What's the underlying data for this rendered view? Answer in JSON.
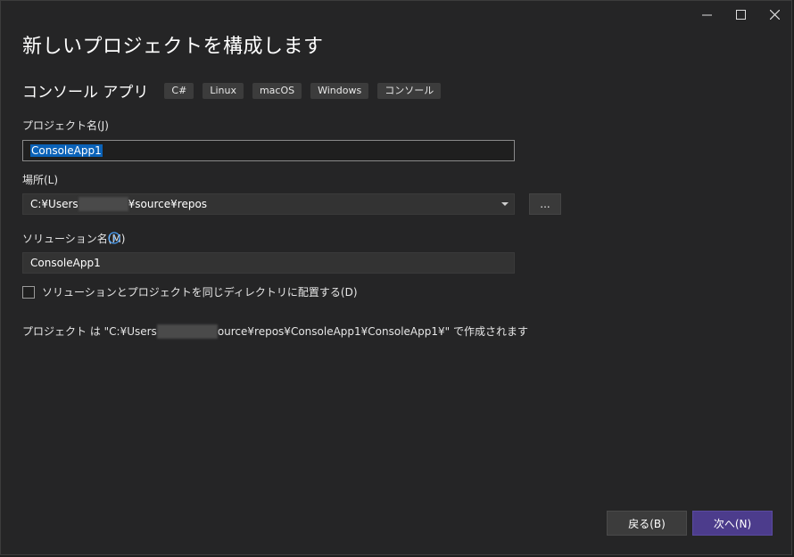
{
  "window": {
    "controls": [
      "minimize-icon",
      "maximize-icon",
      "close-icon"
    ]
  },
  "header": {
    "title": "新しいプロジェクトを構成します"
  },
  "template": {
    "name": "コンソール アプリ",
    "tags": [
      "C#",
      "Linux",
      "macOS",
      "Windows",
      "コンソール"
    ]
  },
  "form": {
    "project_name_label": "プロジェクト名(J)",
    "project_name_value": "ConsoleApp1",
    "location_label": "場所(L)",
    "location_prefix": "C:¥Users",
    "location_suffix": "¥source¥repos",
    "browse_label": "...",
    "solution_name_label": "ソリューション名(M)",
    "solution_name_value": "ConsoleApp1",
    "same_dir_checkbox_label": "ソリューションとプロジェクトを同じディレクトリに配置する(D)",
    "same_dir_checked": false
  },
  "summary": {
    "prefix": "プロジェクト は \"C:¥Users",
    "suffix": "ource¥repos¥ConsoleApp1¥ConsoleApp1¥\" で作成されます"
  },
  "footer": {
    "back_label": "戻る(B)",
    "next_label": "次へ(N)"
  },
  "colors": {
    "background": "#252526",
    "accent_next": "#4c3c8c",
    "selection": "#0a62b8"
  }
}
